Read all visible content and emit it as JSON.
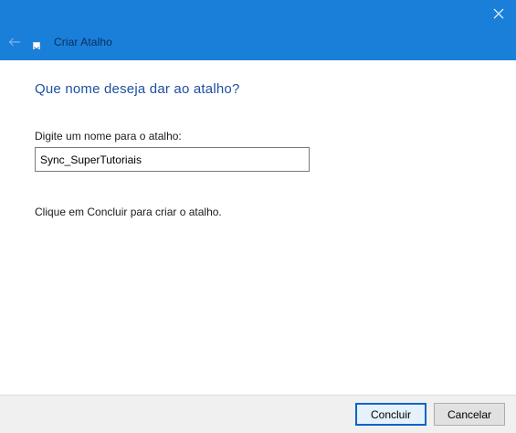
{
  "window": {
    "title": "Criar Atalho",
    "close_icon": "close-icon",
    "back_icon": "back-arrow-icon",
    "app_icon": "shortcut-icon",
    "accent_color": "#1a7fd9"
  },
  "page": {
    "heading": "Que nome deseja dar ao atalho?",
    "name_label": "Digite um nome para o atalho:",
    "name_value": "Sync_SuperTutoriais",
    "hint": "Clique em Concluir para criar o atalho."
  },
  "footer": {
    "finish_label": "Concluir",
    "cancel_label": "Cancelar"
  }
}
